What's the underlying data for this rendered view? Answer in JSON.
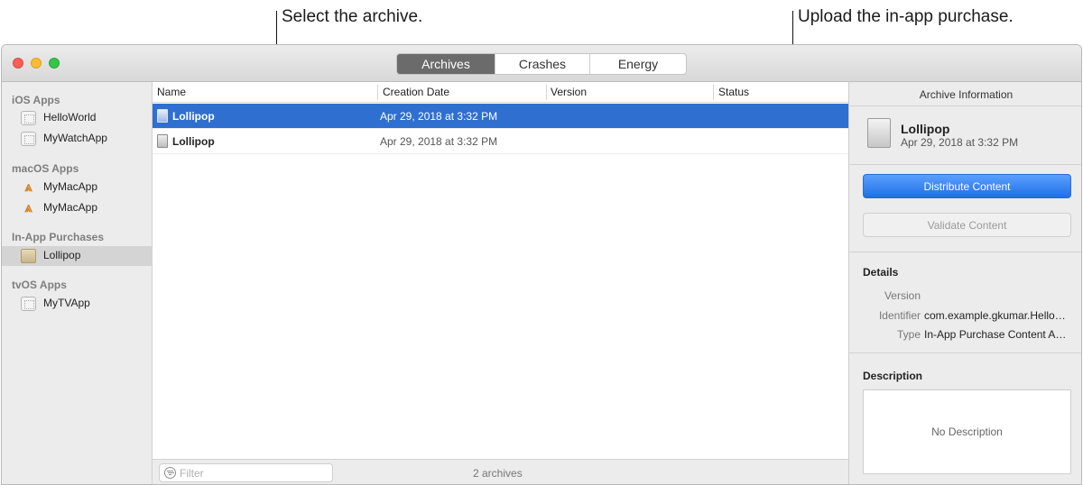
{
  "callouts": {
    "select": "Select the archive.",
    "upload": "Upload the in-app purchase."
  },
  "tabs": [
    {
      "label": "Archives",
      "active": true
    },
    {
      "label": "Crashes",
      "active": false
    },
    {
      "label": "Energy",
      "active": false
    }
  ],
  "sidebar": {
    "sections": [
      {
        "title": "iOS Apps",
        "items": [
          {
            "label": "HelloWorld",
            "icon": "ios-app-icon"
          },
          {
            "label": "MyWatchApp",
            "icon": "ios-app-icon"
          }
        ]
      },
      {
        "title": "macOS Apps",
        "items": [
          {
            "label": "MyMacApp",
            "icon": "mac-app-icon"
          },
          {
            "label": "MyMacApp",
            "icon": "mac-app-icon"
          }
        ]
      },
      {
        "title": "In-App Purchases",
        "items": [
          {
            "label": "Lollipop",
            "icon": "in-app-purchase-icon",
            "selected": true
          }
        ]
      },
      {
        "title": "tvOS Apps",
        "items": [
          {
            "label": "MyTVApp",
            "icon": "tvos-app-icon"
          }
        ]
      }
    ]
  },
  "list": {
    "columns": [
      "Name",
      "Creation Date",
      "Version",
      "Status"
    ],
    "rows": [
      {
        "name": "Lollipop",
        "date": "Apr 29, 2018 at 3:32 PM",
        "selected": true
      },
      {
        "name": "Lollipop",
        "date": "Apr 29, 2018 at 3:32 PM",
        "selected": false
      }
    ],
    "filter_placeholder": "Filter",
    "count": "2 archives"
  },
  "inspector": {
    "title": "Archive Information",
    "archive_name": "Lollipop",
    "archive_date": "Apr 29, 2018 at 3:32 PM",
    "distribute_label": "Distribute Content",
    "validate_label": "Validate Content",
    "details_title": "Details",
    "details": [
      {
        "label": "Version",
        "value": ""
      },
      {
        "label": "Identifier",
        "value": "com.example.gkumar.Hello…"
      },
      {
        "label": "Type",
        "value": "In-App Purchase Content A…"
      }
    ],
    "description_title": "Description",
    "description_text": "No Description"
  },
  "colors": {
    "selection": "#2f6fd0",
    "primary_button": "#1f6fe6",
    "close": "#fc5f57",
    "minimize": "#fdbc2e",
    "maximize": "#33c748"
  }
}
